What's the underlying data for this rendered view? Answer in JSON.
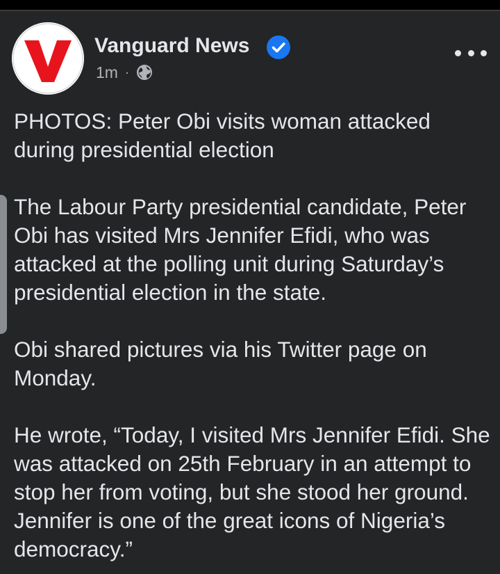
{
  "post": {
    "page_name": "Vanguard News",
    "time_ago": "1m",
    "separator": "·",
    "visibility_icon": "globe-icon",
    "verified_icon": "verified-badge-icon",
    "more_icon": "more-options-icon",
    "logo_letter": "V",
    "paragraphs": [
      "PHOTOS: Peter Obi visits woman attacked during presidential election",
      "The Labour Party presidential candidate, Peter Obi has visited Mrs Jennifer Efidi, who was attacked at the polling unit during Saturday’s presidential election in the state.",
      "Obi shared pictures via his Twitter page on Monday.",
      "He wrote, “Today, I visited Mrs Jennifer Efidi. She was attacked on 25th February in an attempt to stop her from voting, but she stood her ground. Jennifer is one of the great icons of Nigeria’s democracy.”"
    ]
  },
  "colors": {
    "background": "#242526",
    "text": "#e4e6eb",
    "secondary_text": "#b0b3b8",
    "verified_blue": "#1877f2",
    "logo_red": "#e8141d"
  }
}
